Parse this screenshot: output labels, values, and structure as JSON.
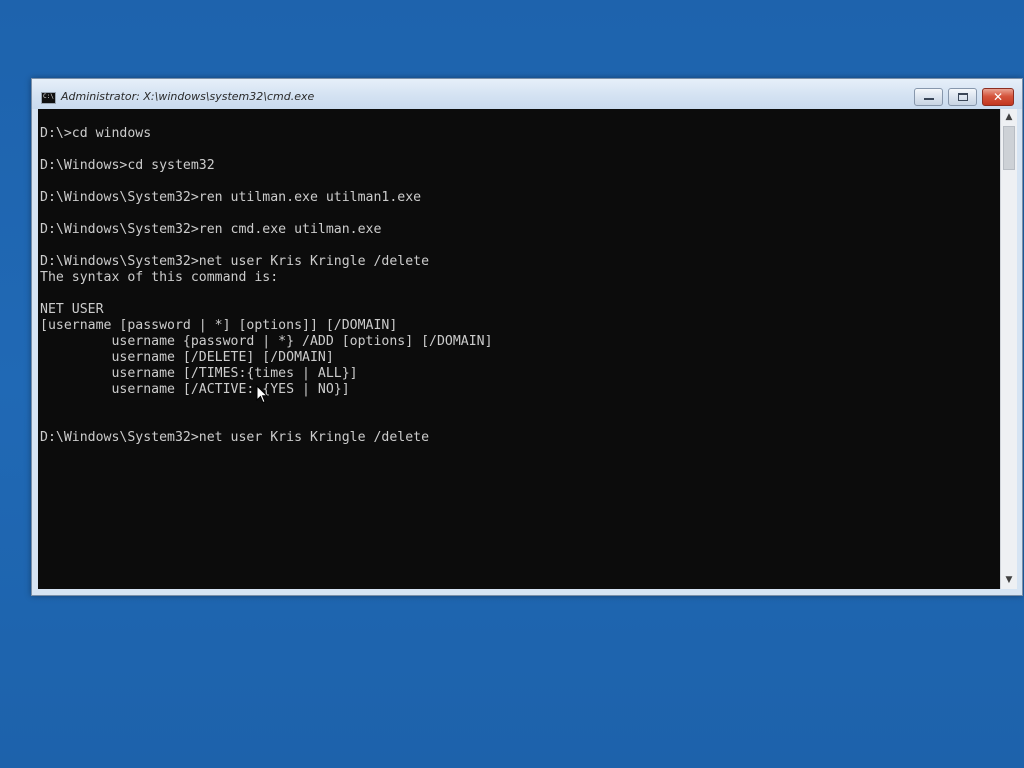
{
  "window": {
    "title": "Administrator: X:\\windows\\system32\\cmd.exe",
    "controls": {
      "minimize_icon": "minimize-icon",
      "maximize_icon": "maximize-icon",
      "close_glyph": "✕"
    }
  },
  "console": {
    "lines": [
      "D:\\>cd windows",
      "",
      "D:\\Windows>cd system32",
      "",
      "D:\\Windows\\System32>ren utilman.exe utilman1.exe",
      "",
      "D:\\Windows\\System32>ren cmd.exe utilman.exe",
      "",
      "D:\\Windows\\System32>net user Kris Kringle /delete",
      "The syntax of this command is:",
      "",
      "NET USER",
      "[username [password | *] [options]] [/DOMAIN]",
      "         username {password | *} /ADD [options] [/DOMAIN]",
      "         username [/DELETE] [/DOMAIN]",
      "         username [/TIMES:{times | ALL}]",
      "         username [/ACTIVE: {YES | NO}]",
      "",
      "",
      "D:\\Windows\\System32>net user Kris Kringle /delete"
    ],
    "foreground": "#cccccc",
    "background": "#0c0c0c"
  },
  "scrollbar": {
    "up_arrow": "▲",
    "down_arrow": "▼"
  },
  "desktop": {
    "background": "#1f66b0"
  }
}
